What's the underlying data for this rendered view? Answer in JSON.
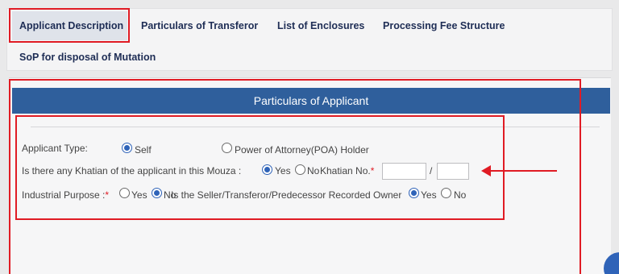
{
  "tabs": [
    {
      "label": "Applicant Description",
      "active": true
    },
    {
      "label": "Particulars of Transferor",
      "active": false
    },
    {
      "label": "List of Enclosures",
      "active": false
    },
    {
      "label": "Processing Fee Structure",
      "active": false
    },
    {
      "label": "SoP for disposal of Mutation",
      "active": false
    }
  ],
  "panel": {
    "title": "Particulars of Applicant"
  },
  "form": {
    "applicant_type_label": "Applicant Type:",
    "applicant_type_options": [
      {
        "label": "Self",
        "checked": true
      },
      {
        "label": "Power of Attorney(POA) Holder",
        "checked": false
      }
    ],
    "khatian_question": "Is there any Khatian of the applicant in this Mouza :",
    "khatian_options": [
      {
        "label": "Yes",
        "checked": true
      },
      {
        "label": "No",
        "checked": false
      }
    ],
    "khatian_no_label": "Khatian No.",
    "khatian_required": "*",
    "khatian_separator": "/",
    "khatian_no_part1": "",
    "khatian_no_part2": "",
    "industrial_label": "Industrial Purpose :",
    "industrial_required": "*",
    "industrial_options": [
      {
        "label": "Yes",
        "checked": false
      },
      {
        "label": "No",
        "checked": true
      }
    ],
    "seller_question": "Is the Seller/Transferor/Predecessor Recorded Owner",
    "seller_options": [
      {
        "label": "Yes",
        "checked": true
      },
      {
        "label": "No",
        "checked": false
      }
    ]
  },
  "colors": {
    "header_bg": "#2f5f9c",
    "annotation_red": "#e01b24",
    "radio_checked": "#2f63b8"
  }
}
